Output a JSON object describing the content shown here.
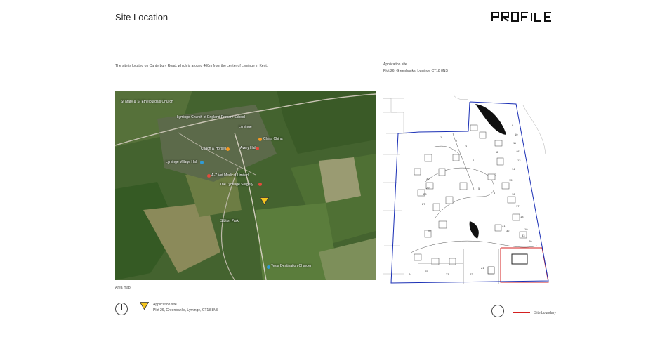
{
  "header": {
    "title": "Site Location",
    "logo_text": "PROFILE"
  },
  "intro": "The site is located on Canterbury Road, which is around 400m from the center of Lyminge in Kent.",
  "application": {
    "title": "Application site",
    "address": "Plot 26, Greenbanks, Lyminge CT18 8NS"
  },
  "map": {
    "caption": "Area map",
    "places": [
      "St Mary & St Ethelburga's Church",
      "Lyminge Church of England Primary School",
      "Lyminge",
      "China China",
      "Coach & Horses",
      "Avery Hall",
      "Lyminge Village Hall",
      "A-Z Vet Medical Limited",
      "The Lyminge Surgery",
      "Tesla Destination Charger",
      "Sibton Park"
    ],
    "colors": {
      "marker": "#f4c51f",
      "pin_red": "#e44a3c",
      "pin_orange": "#f59a23",
      "pin_blue": "#2f9bd6"
    }
  },
  "legend": {
    "marker_title": "Application site",
    "marker_address": "Plot 26, Greenbanks, Lyminge, CT18 8NS",
    "boundary_label": "Site boundary",
    "boundary_color": "#d42020",
    "plan_outline_color": "#1a2fb5"
  },
  "plan": {
    "plot_numbers": [
      "1",
      "2",
      "3",
      "4",
      "5",
      "6",
      "7",
      "8",
      "9",
      "10",
      "11",
      "12",
      "13",
      "14",
      "15",
      "16",
      "17",
      "18",
      "19",
      "20",
      "21",
      "22",
      "23",
      "24",
      "25",
      "26",
      "27",
      "28",
      "29",
      "30",
      "31",
      "32",
      "33"
    ]
  }
}
